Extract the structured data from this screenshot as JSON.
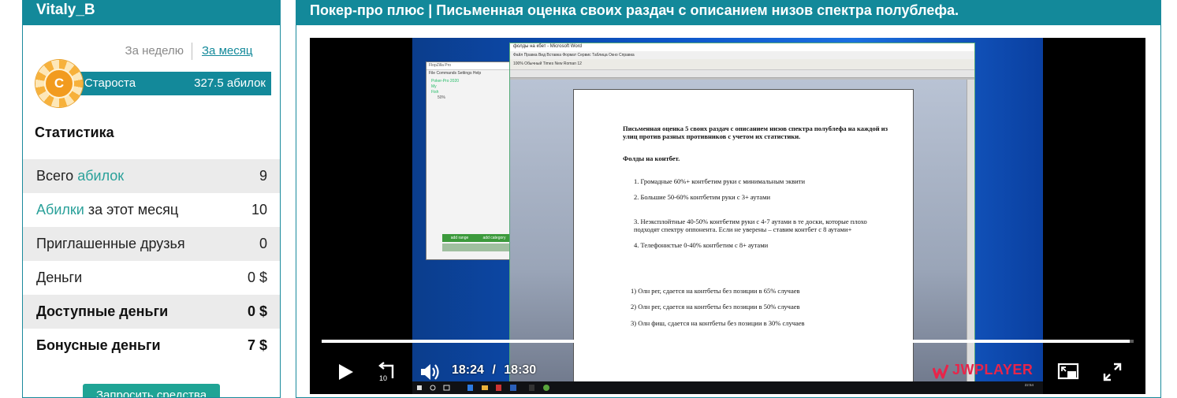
{
  "sidebar": {
    "username": "Vitaly_B",
    "period_week": "За неделю",
    "period_month": "За месяц",
    "chip_letter": "C",
    "level_name": "Староста",
    "level_value": "327.5 абилок",
    "stats_title": "Статистика",
    "stats": [
      {
        "pre": "Всего ",
        "accent": "абилок",
        "post": "",
        "value": "9"
      },
      {
        "pre": "",
        "accent": "Абилки",
        "post": " за этот месяц",
        "value": "10"
      },
      {
        "pre": "Приглашенные друзья",
        "accent": "",
        "post": "",
        "value": "0"
      },
      {
        "pre": "Деньги",
        "accent": "",
        "post": "",
        "value": "0 $"
      },
      {
        "pre": "Доступные деньги",
        "accent": "",
        "post": "",
        "value": "0 $"
      },
      {
        "pre": "Бонусные деньги",
        "accent": "",
        "post": "",
        "value": "7 $"
      }
    ],
    "request_button": "Запросить средства"
  },
  "main": {
    "title": "Покер-про плюс | Письменная оценка своих раздач с описанием низов спектра полублефа."
  },
  "player": {
    "time_current": "18:24",
    "time_separator": "/",
    "time_total": "18:30",
    "progress": 0.995,
    "brand": "JWPLAYER",
    "brand_color": "#e8254a"
  },
  "video_frame": {
    "app_title": "FlopZilla Pro",
    "app_menu": "File  Commands  Settings  Help",
    "app_tree": [
      "Poker-Pro 2020",
      "My",
      "Fish",
      "50%"
    ],
    "app_btn_range": "add range",
    "app_btn_category": "add category",
    "word_title": "фолды на кбет - Microsoft Word",
    "word_menu": "Файл  Правка  Вид  Вставка  Формат  Сервис  Таблица  Окно  Справка",
    "word_tool": "100%   Обычный   Times New Roman   12",
    "doc_heading": "Письменная оценка 5 своих раздач с описанием низов спектра полублефа на каждой из улиц против разных противников с учетом их статистики.",
    "doc_sub": "Фолды на контбет.",
    "doc_list": [
      "1.   Громадные    60%+               контбетим руки с минимальным эквити",
      "2.   Большие    50-60%               контбетим руки с 3+ аутами",
      "3.   Неэксплойтные    40-50%    контбетим руки с 4-7 аутами в те доски, которые плохо подходят спектру оппонента. Если не уверены – ставим контбет с 8 аутами+",
      "4.   Телефонистые 0-40%            контбетим с 8+ аутами"
    ],
    "doc_list2": [
      "1)   Олн рег, сдается на контбеты без позиции в 65% случаев",
      "2)   Олн рег, сдается на контбеты без позиции в 50% случаев",
      "3)   Олн фиш, сдается на контбеты без позиции в 30% случаев"
    ],
    "clock": "22:54"
  }
}
